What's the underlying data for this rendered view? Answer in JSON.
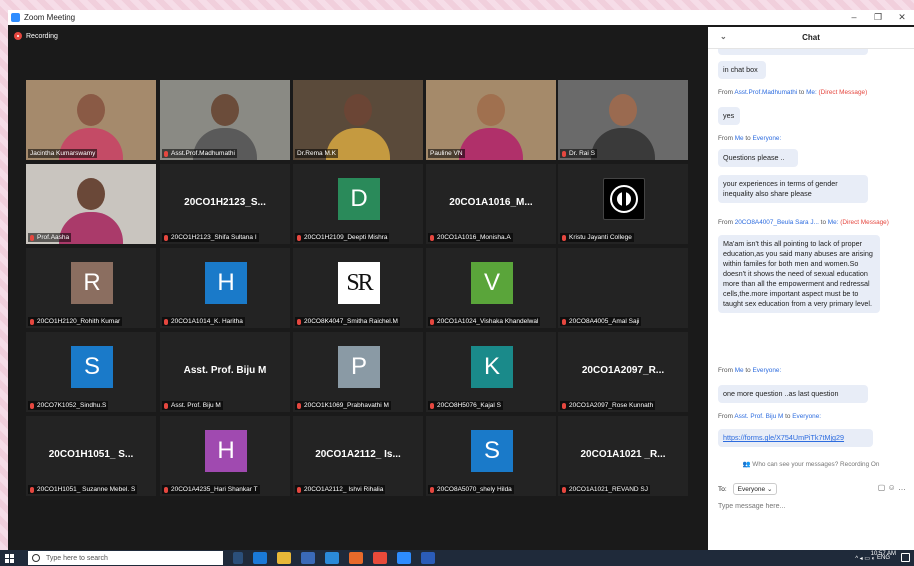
{
  "window": {
    "title": "Zoom Meeting",
    "controls": [
      "–",
      "❐",
      "✕"
    ]
  },
  "recording": "Recording",
  "tiles": [
    {
      "name": "Jacintha Kumarswamy",
      "type": "video",
      "muted": false,
      "active": true,
      "bg": "#a58a6c",
      "skin": "#8a5a45",
      "shirt": "#c44b66"
    },
    {
      "name": "Asst.Prof.Madhumathi",
      "type": "video",
      "muted": true,
      "bg": "#8a8a84",
      "skin": "#6b4c3a",
      "shirt": "#5a5a5a"
    },
    {
      "name": "Dr.Rema M.K",
      "type": "video",
      "muted": false,
      "bg": "#5a4a3a",
      "skin": "#6b4535",
      "shirt": "#c59a40"
    },
    {
      "name": "Pauline VN",
      "type": "video",
      "muted": false,
      "bg": "#a58a6a",
      "skin": "#a0704f",
      "shirt": "#b0306a"
    },
    {
      "name": "Dr. Rai S",
      "type": "video",
      "muted": true,
      "bg": "#6a6a6a",
      "skin": "#9a6a50",
      "shirt": "#3a3a3a"
    },
    {
      "name": "Prof.Aasha",
      "type": "video",
      "muted": true,
      "bg": "#c9c5bf",
      "skin": "#6a4838",
      "shirt": "#aa3a6a"
    },
    {
      "name": "20CO1H2123_Shifa Sultana I",
      "big": "20CO1H2123_S...",
      "type": "text",
      "muted": true
    },
    {
      "name": "20CO1H2109_Deepti Mishra",
      "letter": "D",
      "color": "#2a8a5a",
      "type": "avatar",
      "muted": true
    },
    {
      "name": "20CO1A1016_Monisha.A",
      "big": "20CO1A1016_M...",
      "type": "text",
      "muted": true
    },
    {
      "name": "Kristu Jayanti College",
      "type": "logo",
      "muted": true
    },
    {
      "name": "20CO1H2120_Rohith Kumar",
      "letter": "R",
      "color": "#8b6e60",
      "type": "avatar",
      "muted": true
    },
    {
      "name": "20CO1A1014_K. Haritha",
      "letter": "H",
      "color": "#1a7ac9",
      "type": "avatar",
      "muted": true
    },
    {
      "name": "20CO8K4047_Smitha Raichel.M",
      "letter": "SR",
      "type": "sr",
      "muted": true
    },
    {
      "name": "20CO1A1024_Vishaka Khandelwal",
      "letter": "V",
      "color": "#5aa53a",
      "type": "avatar",
      "muted": true
    },
    {
      "name": "20CO8A4005_Amal Saji",
      "type": "blank",
      "muted": true
    },
    {
      "name": "20CO7K1052_Sindhu.S",
      "letter": "S",
      "color": "#1a7ac9",
      "type": "avatar",
      "muted": true
    },
    {
      "name": "Asst. Prof. Biju M",
      "big": "Asst. Prof. Biju M",
      "type": "text",
      "muted": true
    },
    {
      "name": "20CO1K1069_Prabhavathi M",
      "letter": "P",
      "color": "#8a9aa5",
      "type": "avatar",
      "muted": true
    },
    {
      "name": "20CO8H5076_Kajal S",
      "letter": "K",
      "color": "#1a8a8a",
      "type": "avatar",
      "muted": true
    },
    {
      "name": "20CO1A2097_Rose Kunnath",
      "big": "20CO1A2097_R...",
      "type": "text",
      "muted": true
    },
    {
      "name": "20CO1H1051_ Suzanne Mebel. S",
      "big": "20CO1H1051_ S...",
      "type": "text",
      "muted": true
    },
    {
      "name": "20CO1A4235_Hari Shankar T",
      "letter": "H",
      "color": "#a04ab0",
      "type": "avatar",
      "muted": true
    },
    {
      "name": "20CO1A2112_ Ishvi Rihalia",
      "big": "20CO1A2112_ Is...",
      "type": "text",
      "muted": true
    },
    {
      "name": "20CO8A5070_shely Hilda",
      "letter": "S",
      "color": "#1a7ac9",
      "type": "avatar",
      "muted": true
    },
    {
      "name": "20CO1A1021_REVAND SJ",
      "big": "20CO1A1021 _R...",
      "type": "text",
      "muted": true
    }
  ],
  "chat": {
    "title": "Chat",
    "messages": [
      {
        "kind": "bubble",
        "text": "in chat box"
      },
      {
        "kind": "from",
        "sender": "Asst.Prof.Madhumathi",
        "to": "Me:",
        "dm": "(Direct Message)"
      },
      {
        "kind": "bubble",
        "text": "yes"
      },
      {
        "kind": "from",
        "sender": "Me",
        "to": "Everyone:"
      },
      {
        "kind": "bubble",
        "text": "Questions please .."
      },
      {
        "kind": "bubble",
        "text": "your experiences in terms of gender inequality also share please"
      },
      {
        "kind": "from",
        "sender": "20CO8A4007_Beula Sara J...",
        "to": "Me:",
        "dm": "(Direct Message)"
      },
      {
        "kind": "bubble",
        "text": "Ma'am isn't this all pointing to lack of proper education,as you said many abuses are arising within familes for both men and women.So doesn't it shows the need of sexual education more than all the empowerment and redressal cells,the.more important aspect must be to taught sex education from a very primary level."
      },
      {
        "kind": "from",
        "sender": "Me",
        "to": "Everyone:"
      },
      {
        "kind": "bubble",
        "text": "one more question ..as last question"
      },
      {
        "kind": "from",
        "sender": "Asst. Prof. Biju M",
        "to": "Everyone:"
      },
      {
        "kind": "bubble",
        "text": "https://forms.gle/X754UmPiTk7tMjg29",
        "link": true
      }
    ],
    "visibility": "Who can see your messages? Recording On",
    "to_label": "To:",
    "to_value": "Everyone",
    "placeholder": "Type message here..."
  },
  "taskbar": {
    "search_placeholder": "Type here to search",
    "time": "10:57 AM",
    "lang": "ENG"
  }
}
